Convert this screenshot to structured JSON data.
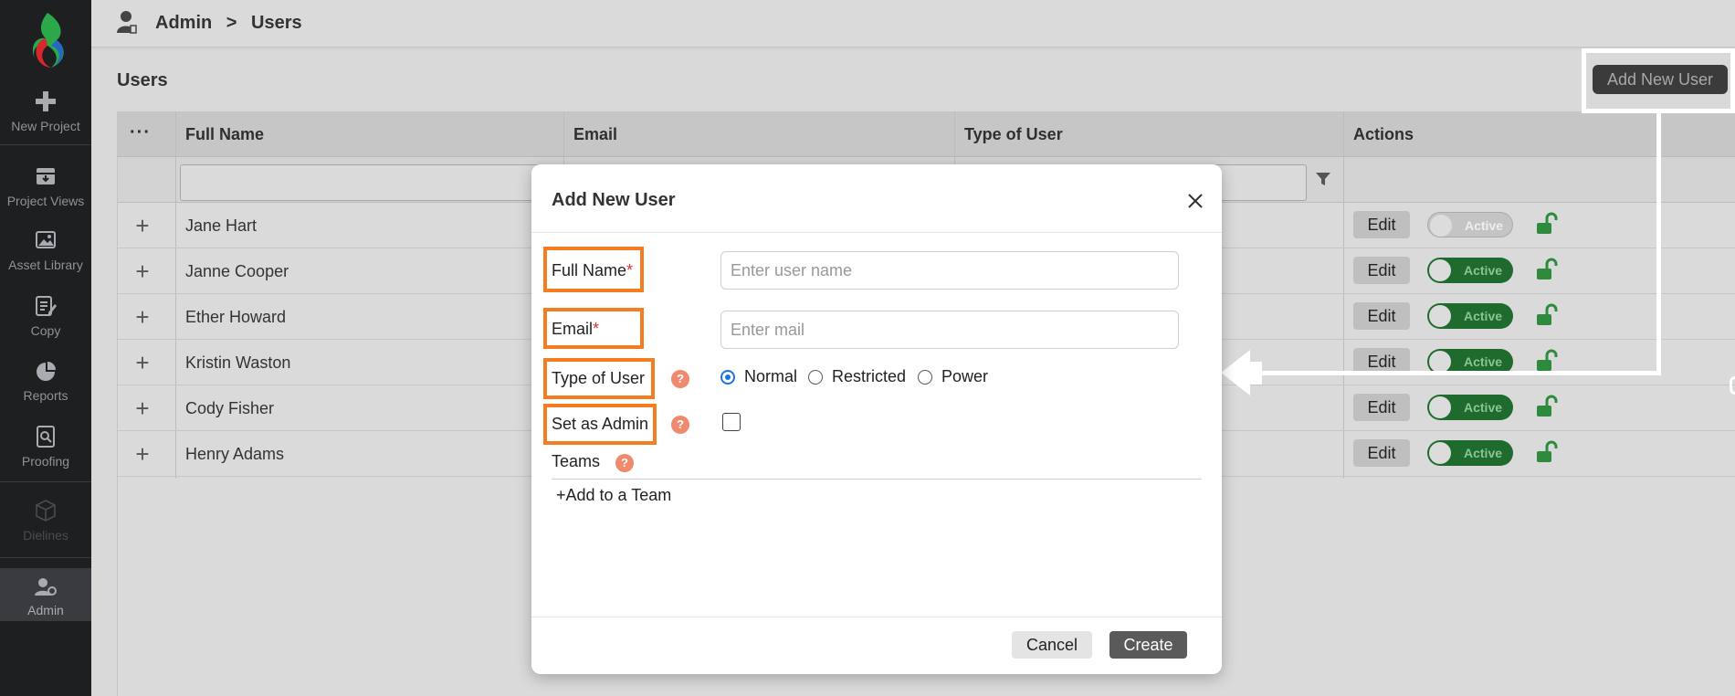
{
  "sidebar": {
    "logo_icon": "app-logo",
    "items": [
      {
        "label": "New Project",
        "icon": "plus-icon"
      },
      {
        "label": "Project Views",
        "icon": "archive-icon"
      },
      {
        "label": "Asset Library",
        "icon": "image-icon"
      },
      {
        "label": "Copy",
        "icon": "edit-document-icon"
      },
      {
        "label": "Reports",
        "icon": "pie-chart-icon"
      },
      {
        "label": "Proofing",
        "icon": "proof-search-icon"
      },
      {
        "label": "Dielines",
        "icon": "box-icon",
        "disabled": true
      },
      {
        "label": "Admin",
        "icon": "user-gear-icon",
        "active": true
      }
    ]
  },
  "header": {
    "breadcrumb": [
      "Admin",
      ">",
      "Users"
    ]
  },
  "page": {
    "title": "Users",
    "add_user_label": "Add New User"
  },
  "table": {
    "menu_glyph": "···",
    "columns": [
      "Full Name",
      "Email",
      "Type of User",
      "Actions"
    ],
    "rows": [
      {
        "name": "Jane Hart",
        "status": "Active",
        "active": false
      },
      {
        "name": "Janne Cooper",
        "status": "Active",
        "active": true
      },
      {
        "name": "Ether Howard",
        "status": "Active",
        "active": true
      },
      {
        "name": "Kristin Waston",
        "status": "Active",
        "active": true
      },
      {
        "name": "Cody Fisher",
        "status": "Active",
        "active": true
      },
      {
        "name": "Henry Adams",
        "status": "Active",
        "active": true
      }
    ],
    "edit_label": "Edit"
  },
  "modal": {
    "title": "Add New User",
    "full_name_label": "Full Name",
    "full_name_placeholder": "Enter user name",
    "email_label": "Email",
    "email_placeholder": "Enter mail",
    "required_mark": "*",
    "type_label": "Type of User",
    "type_options": [
      "Normal",
      "Restricted",
      "Power"
    ],
    "type_selected": "Normal",
    "admin_label": "Set as Admin",
    "admin_checked": false,
    "teams_label": "Teams",
    "add_team_label": "+Add to a Team",
    "help_glyph": "?",
    "cancel_label": "Cancel",
    "create_label": "Create"
  },
  "colors": {
    "highlight": "#f57c20",
    "active_toggle": "#1f6b2e",
    "lock": "#2e8b3e"
  }
}
